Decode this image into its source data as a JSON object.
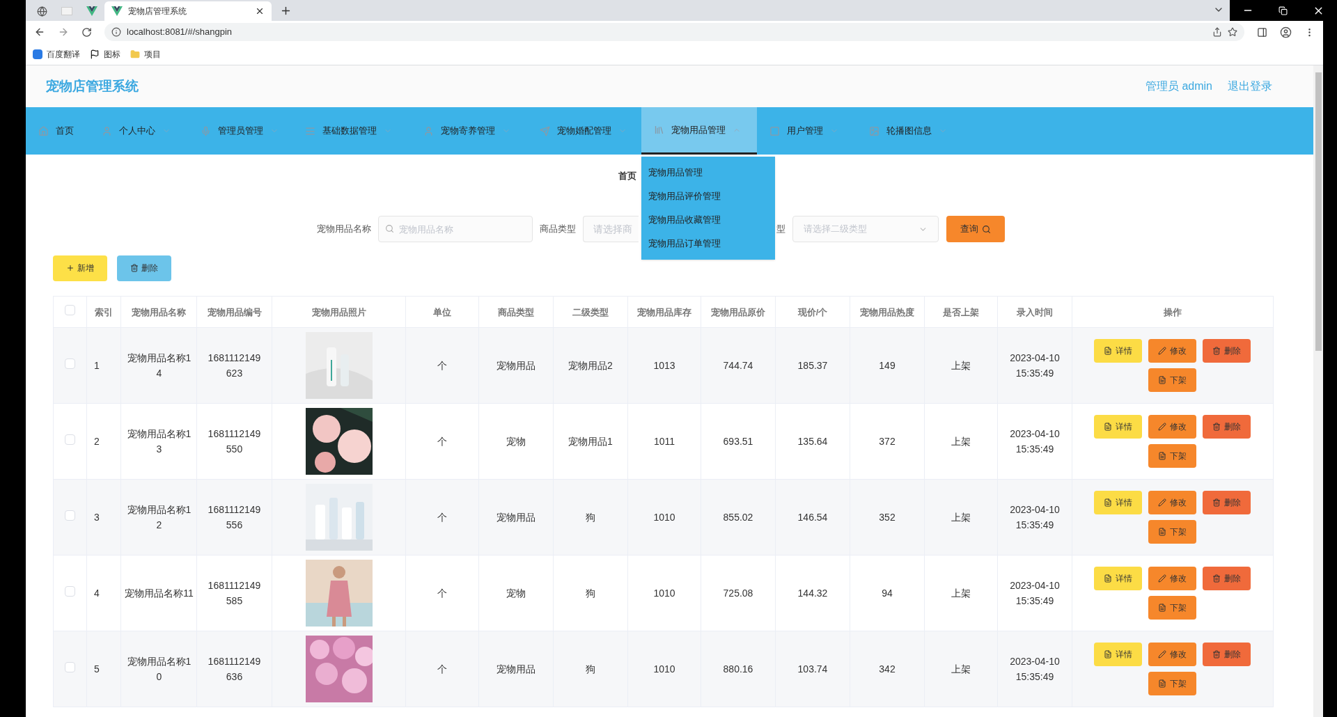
{
  "browser": {
    "tabs": [
      {
        "selected": false
      },
      {
        "selected": false
      },
      {
        "selected": false
      },
      {
        "title": "宠物店管理系统",
        "selected": true
      }
    ],
    "url": "localhost:8081/#/shangpin",
    "bookmarks": [
      {
        "label": "百度翻译"
      },
      {
        "label": "图标"
      },
      {
        "label": "项目"
      }
    ]
  },
  "header": {
    "title": "宠物店管理系统",
    "user": "管理员 admin",
    "logout": "退出登录"
  },
  "nav": [
    {
      "label": "首页",
      "selected": false
    },
    {
      "label": "个人中心",
      "selected": false,
      "expanded": false
    },
    {
      "label": "管理员管理",
      "selected": false,
      "expanded": false
    },
    {
      "label": "基础数据管理",
      "selected": false,
      "expanded": false
    },
    {
      "label": "宠物寄养管理",
      "selected": false,
      "expanded": false
    },
    {
      "label": "宠物婚配管理",
      "selected": false,
      "expanded": false
    },
    {
      "label": "宠物用品管理",
      "selected": true,
      "expanded": true
    },
    {
      "label": "用户管理",
      "selected": false,
      "expanded": false
    },
    {
      "label": "轮播图信息",
      "selected": false,
      "expanded": false
    }
  ],
  "submenu": [
    {
      "label": "宠物用品管理"
    },
    {
      "label": "宠物用品评价管理"
    },
    {
      "label": "宠物用品收藏管理"
    },
    {
      "label": "宠物用品订单管理"
    }
  ],
  "breadcrumb": "首页",
  "search": {
    "name_label": "宠物用品名称",
    "name_placeholder": "宠物用品名称",
    "type_label": "商品类型",
    "type_placeholder": "请选择商",
    "subtype_label": "型",
    "subtype_placeholder": "请选择二级类型",
    "query_button": "查询"
  },
  "toolbar": {
    "add": "新增",
    "delete": "删除"
  },
  "table": {
    "select_all_checked": false,
    "columns": [
      "索引",
      "宠物用品名称",
      "宠物用品编号",
      "宠物用品照片",
      "单位",
      "商品类型",
      "二级类型",
      "宠物用品库存",
      "宠物用品原价",
      "现价/个",
      "宠物用品热度",
      "是否上架",
      "录入时间",
      "操作"
    ],
    "rows": [
      {
        "checked": false,
        "index": "1",
        "name": "宠物用品名称14",
        "code": "1681112149623",
        "unit": "个",
        "type": "宠物用品",
        "subtype": "宠物用品2",
        "stock": "1013",
        "price": "744.74",
        "current_price": "185.37",
        "heat": "149",
        "status": "上架",
        "created": "2023-04-10 15:35:49",
        "actions": [
          {
            "kind": "detail",
            "label": "详情"
          },
          {
            "kind": "edit",
            "label": "修改"
          },
          {
            "kind": "delete",
            "label": "删除"
          },
          {
            "kind": "unlist",
            "label": "下架"
          }
        ]
      },
      {
        "checked": false,
        "index": "2",
        "name": "宠物用品名称13",
        "code": "1681112149550",
        "unit": "个",
        "type": "宠物",
        "subtype": "宠物用品1",
        "stock": "1011",
        "price": "693.51",
        "current_price": "135.64",
        "heat": "372",
        "status": "上架",
        "created": "2023-04-10 15:35:49",
        "actions": [
          {
            "kind": "detail",
            "label": "详情"
          },
          {
            "kind": "edit",
            "label": "修改"
          },
          {
            "kind": "delete",
            "label": "删除"
          },
          {
            "kind": "unlist",
            "label": "下架"
          }
        ]
      },
      {
        "checked": false,
        "index": "3",
        "name": "宠物用品名称12",
        "code": "1681112149556",
        "unit": "个",
        "type": "宠物用品",
        "subtype": "狗",
        "stock": "1010",
        "price": "855.02",
        "current_price": "146.54",
        "heat": "352",
        "status": "上架",
        "created": "2023-04-10 15:35:49",
        "actions": [
          {
            "kind": "detail",
            "label": "详情"
          },
          {
            "kind": "edit",
            "label": "修改"
          },
          {
            "kind": "delete",
            "label": "删除"
          },
          {
            "kind": "unlist",
            "label": "下架"
          }
        ]
      },
      {
        "checked": false,
        "index": "4",
        "name": "宠物用品名称11",
        "code": "1681112149585",
        "unit": "个",
        "type": "宠物",
        "subtype": "狗",
        "stock": "1010",
        "price": "725.08",
        "current_price": "144.32",
        "heat": "94",
        "status": "上架",
        "created": "2023-04-10 15:35:49",
        "actions": [
          {
            "kind": "detail",
            "label": "详情"
          },
          {
            "kind": "edit",
            "label": "修改"
          },
          {
            "kind": "delete",
            "label": "删除"
          },
          {
            "kind": "unlist",
            "label": "下架"
          }
        ]
      },
      {
        "checked": false,
        "index": "5",
        "name": "宠物用品名称10",
        "code": "1681112149636",
        "unit": "个",
        "type": "宠物用品",
        "subtype": "狗",
        "stock": "1010",
        "price": "880.16",
        "current_price": "103.74",
        "heat": "342",
        "status": "上架",
        "created": "2023-04-10 15:35:49",
        "actions": [
          {
            "kind": "detail",
            "label": "详情"
          },
          {
            "kind": "edit",
            "label": "修改"
          },
          {
            "kind": "delete",
            "label": "删除"
          },
          {
            "kind": "unlist",
            "label": "下架"
          }
        ]
      }
    ]
  }
}
